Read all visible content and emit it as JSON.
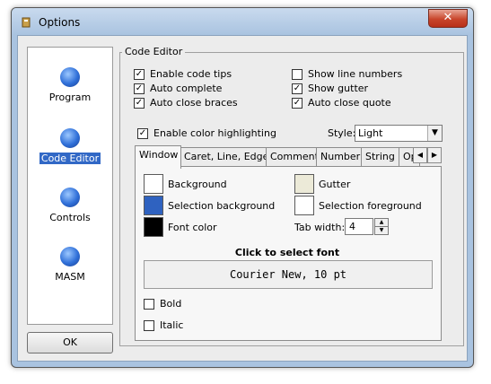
{
  "window": {
    "title": "Options",
    "close_symbol": "✕"
  },
  "sidebar": {
    "items": [
      {
        "label": "Program",
        "selected": false
      },
      {
        "label": "Code Editor",
        "selected": true
      },
      {
        "label": "Controls",
        "selected": false
      },
      {
        "label": "MASM",
        "selected": false
      }
    ],
    "ok_label": "OK"
  },
  "group": {
    "title": "Code Editor"
  },
  "checks": {
    "code_tips": {
      "label": "Enable code tips",
      "checked": true
    },
    "auto_complete": {
      "label": "Auto complete",
      "checked": true
    },
    "auto_close_braces": {
      "label": "Auto close braces",
      "checked": true
    },
    "show_line_numbers": {
      "label": "Show line numbers",
      "checked": false
    },
    "show_gutter": {
      "label": "Show gutter",
      "checked": true
    },
    "auto_close_quote": {
      "label": "Auto close quote",
      "checked": true
    },
    "color_highlighting": {
      "label": "Enable color highlighting",
      "checked": true
    }
  },
  "style": {
    "label": "Style:",
    "value": "Light"
  },
  "tabs": [
    "Window",
    "Caret, Line, Edge",
    "Comment",
    "Number",
    "String",
    "Op"
  ],
  "colors": {
    "background": {
      "label": "Background",
      "color": "#ffffff"
    },
    "selection_background": {
      "label": "Selection background",
      "color": "#2f62c0"
    },
    "font_color": {
      "label": "Font color",
      "color": "#000000"
    },
    "gutter": {
      "label": "Gutter",
      "color": "#ecead8"
    },
    "selection_foreground": {
      "label": "Selection foreground",
      "color": "#ffffff"
    }
  },
  "tab_width": {
    "label": "Tab width:",
    "value": "4"
  },
  "font": {
    "title": "Click to select font",
    "value": "Courier New, 10 pt"
  },
  "bold": {
    "label": "Bold",
    "checked": false
  },
  "italic": {
    "label": "Italic",
    "checked": false
  },
  "check_symbol": "✓"
}
